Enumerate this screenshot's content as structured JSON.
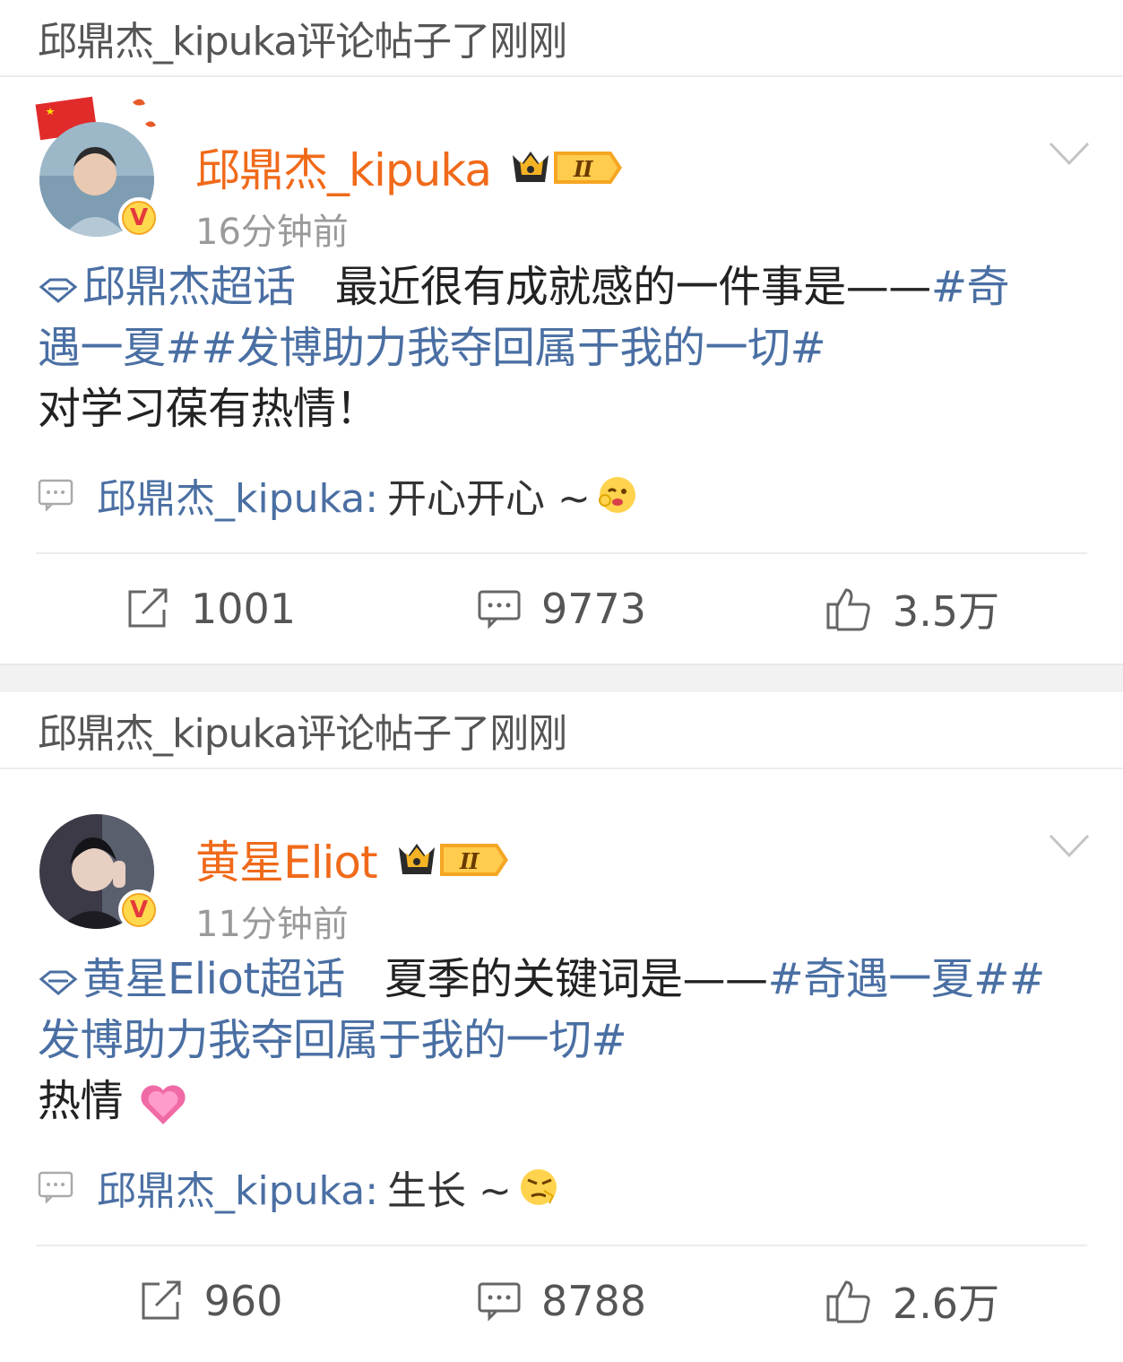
{
  "posts": [
    {
      "header": "邱鼎杰_kipuka评论帖子了刚刚",
      "username": "邱鼎杰_kipuka",
      "time": "16分钟前",
      "topic": "邱鼎杰超话",
      "text_main": "最近很有成就感的一件事是——",
      "hashtags_line1": "#奇",
      "hashtags_line2": "遇一夏##发博助力我夺回属于我的一切#",
      "text_last": "对学习葆有热情！",
      "comment_user": "邱鼎杰_kipuka:",
      "comment_text": "开心开心 ~",
      "shares": "1001",
      "comments": "9773",
      "likes": "3.5万"
    },
    {
      "header": "邱鼎杰_kipuka评论帖子了刚刚",
      "username": "黄星Eliot",
      "time": "11分钟前",
      "topic": "黄星Eliot超话",
      "text_main": "夏季的关键词是——",
      "hashtags_line1": "#奇遇一夏##",
      "hashtags_line2": "发博助力我夺回属于我的一切#",
      "text_last": "热情",
      "comment_user": "邱鼎杰_kipuka:",
      "comment_text": "生长 ~",
      "shares": "960",
      "comments": "8788",
      "likes": "2.6万"
    }
  ],
  "icons": {
    "verified_badge": "V",
    "vip_level": "II"
  },
  "colors": {
    "username": "#f06a1a",
    "link": "#4a6fa3"
  }
}
